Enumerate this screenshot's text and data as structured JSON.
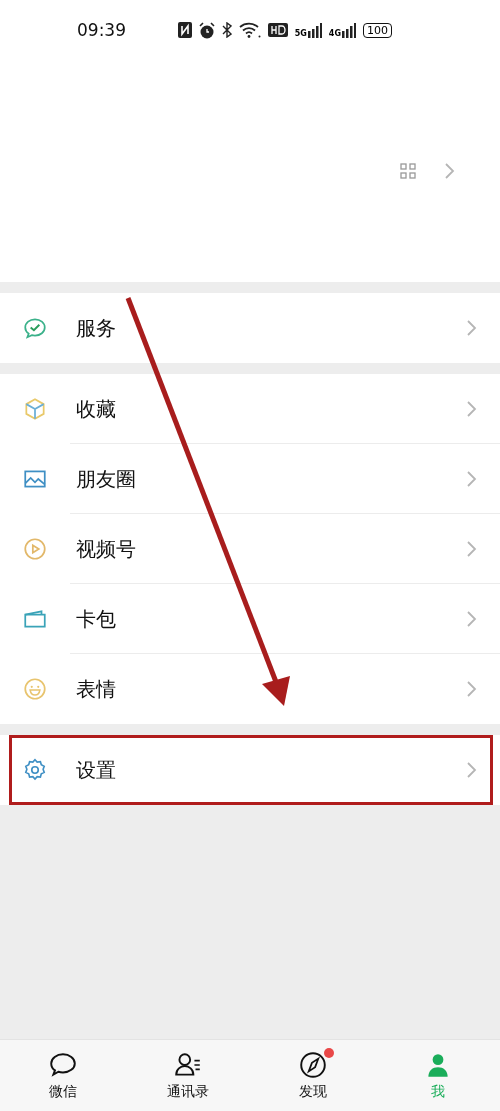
{
  "status_bar": {
    "time": "09:39",
    "signals": [
      "5G",
      "4G"
    ],
    "battery": "100"
  },
  "groups": [
    {
      "items": [
        {
          "label": "服务",
          "kind": "service",
          "highlighted": false
        }
      ]
    },
    {
      "items": [
        {
          "label": "收藏",
          "kind": "favorites",
          "highlighted": false
        },
        {
          "label": "朋友圈",
          "kind": "moments",
          "highlighted": false
        },
        {
          "label": "视频号",
          "kind": "channels",
          "highlighted": false
        },
        {
          "label": "卡包",
          "kind": "cards",
          "highlighted": false
        },
        {
          "label": "表情",
          "kind": "stickers",
          "highlighted": false
        }
      ]
    },
    {
      "items": [
        {
          "label": "设置",
          "kind": "settings",
          "highlighted": true
        }
      ]
    }
  ],
  "arrow": true,
  "tabs": [
    {
      "label": "微信",
      "kind": "chat",
      "selected": false,
      "badge": false
    },
    {
      "label": "通讯录",
      "kind": "contacts",
      "selected": false,
      "badge": false
    },
    {
      "label": "发现",
      "kind": "discover",
      "selected": false,
      "badge": true
    },
    {
      "label": "我",
      "kind": "me",
      "selected": true,
      "badge": false
    }
  ]
}
